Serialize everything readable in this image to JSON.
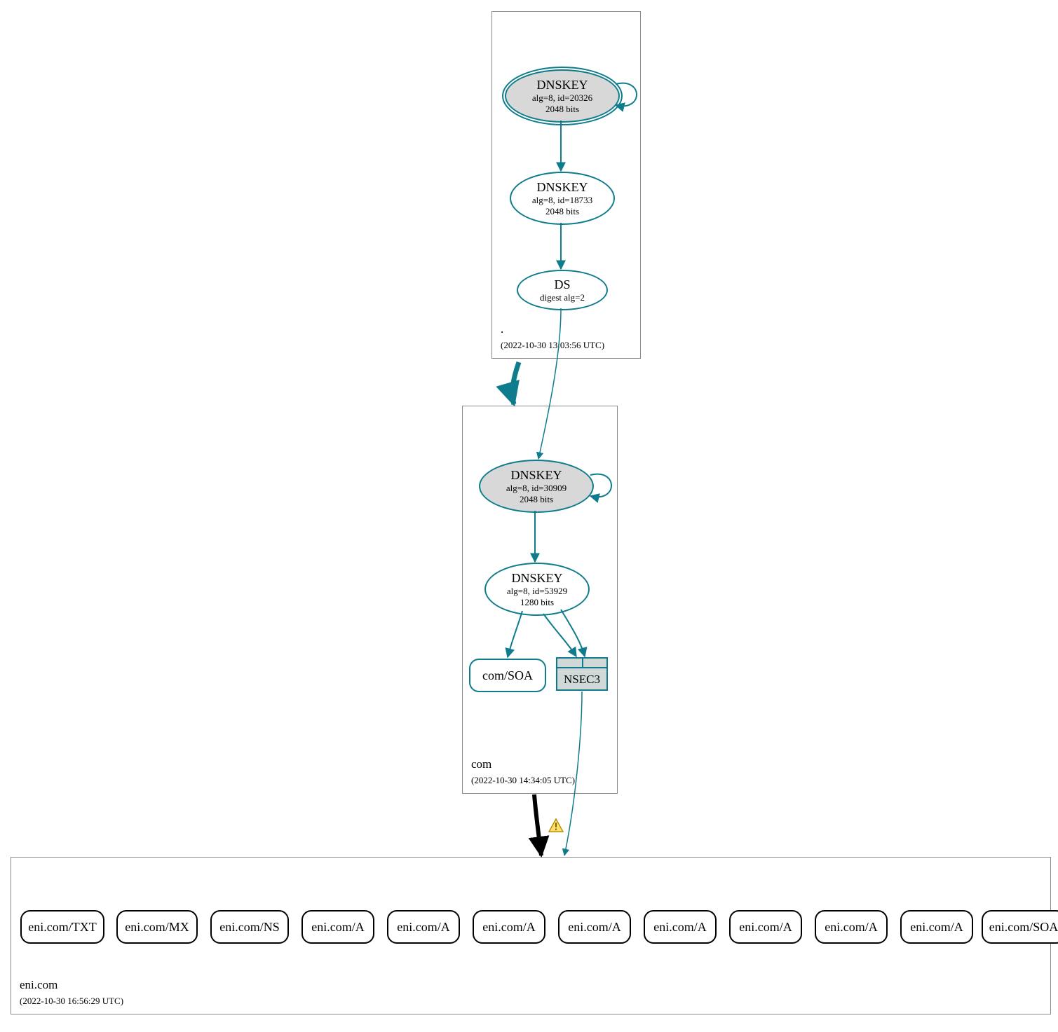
{
  "zones": {
    "root": {
      "name": ".",
      "timestamp": "(2022-10-30 13:03:56 UTC)"
    },
    "com": {
      "name": "com",
      "timestamp": "(2022-10-30 14:34:05 UTC)"
    },
    "eni": {
      "name": "eni.com",
      "timestamp": "(2022-10-30 16:56:29 UTC)"
    }
  },
  "nodes": {
    "root_ksk": {
      "title": "DNSKEY",
      "sub1": "alg=8, id=20326",
      "sub2": "2048 bits"
    },
    "root_zsk": {
      "title": "DNSKEY",
      "sub1": "alg=8, id=18733",
      "sub2": "2048 bits"
    },
    "root_ds": {
      "title": "DS",
      "sub1": "digest alg=2"
    },
    "com_ksk": {
      "title": "DNSKEY",
      "sub1": "alg=8, id=30909",
      "sub2": "2048 bits"
    },
    "com_zsk": {
      "title": "DNSKEY",
      "sub1": "alg=8, id=53929",
      "sub2": "1280 bits"
    },
    "com_soa": {
      "label": "com/SOA"
    },
    "nsec3": {
      "label": "NSEC3"
    },
    "eni_records": [
      "eni.com/TXT",
      "eni.com/MX",
      "eni.com/NS",
      "eni.com/A",
      "eni.com/A",
      "eni.com/A",
      "eni.com/A",
      "eni.com/A",
      "eni.com/A",
      "eni.com/A",
      "eni.com/A",
      "eni.com/SOA"
    ]
  },
  "colors": {
    "teal": "#0e7c8c",
    "gray_fill": "#d8d8d8"
  }
}
